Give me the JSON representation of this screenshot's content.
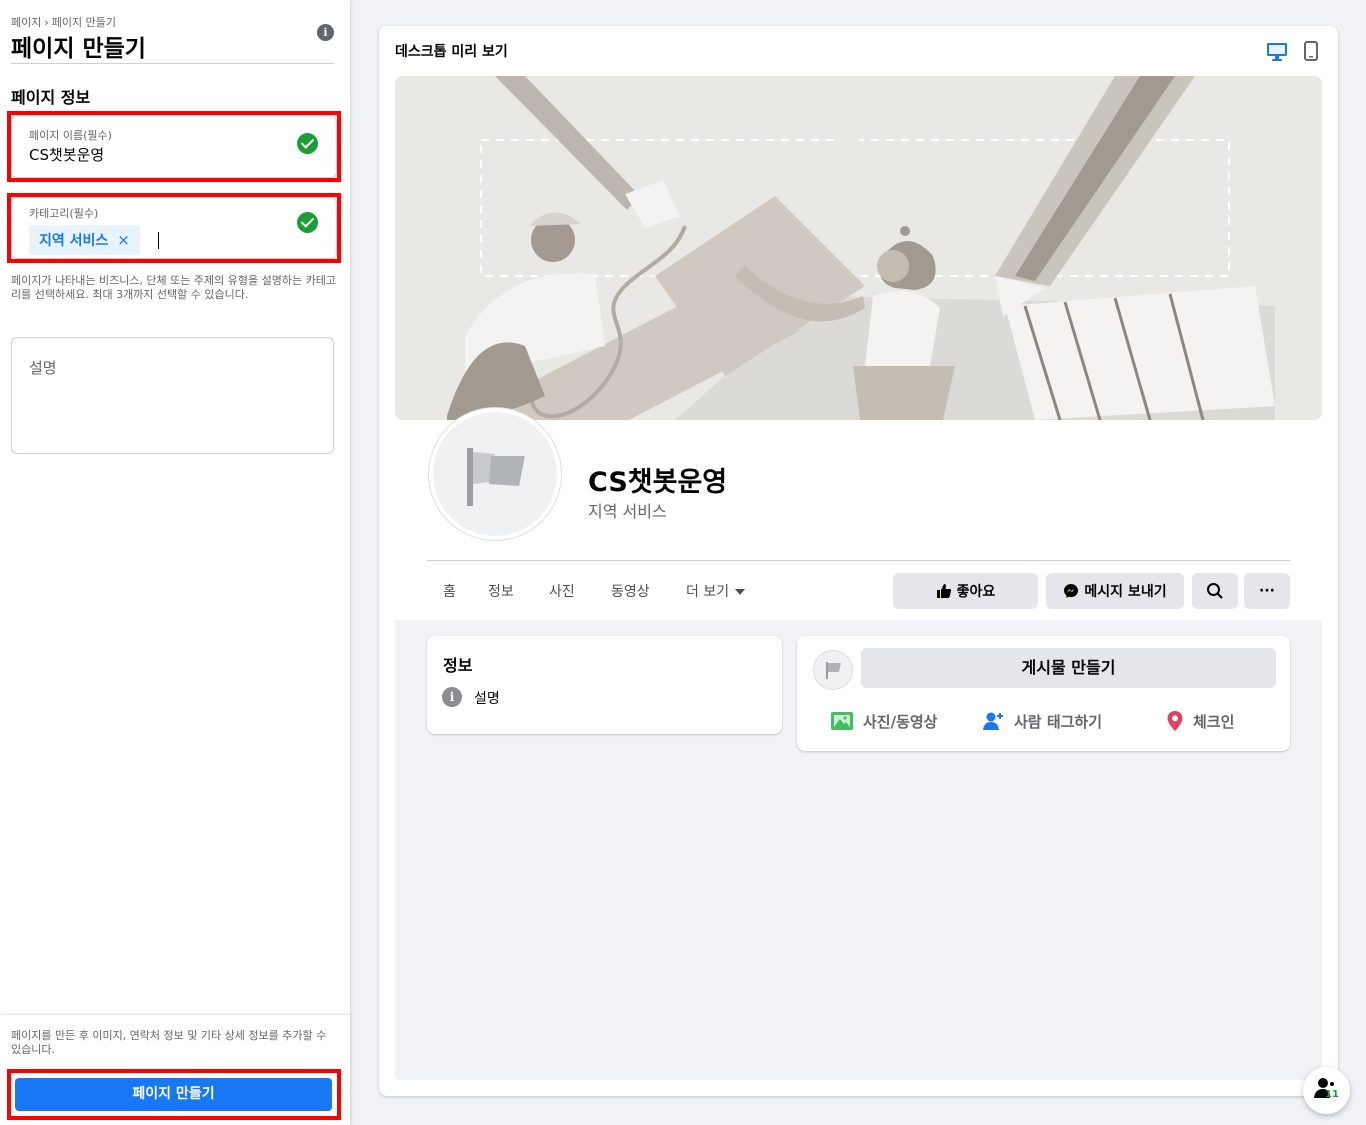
{
  "sidebar": {
    "breadcrumb": [
      "페이지",
      "페이지 만들기"
    ],
    "breadcrumb_separator": "›",
    "title": "페이지 만들기",
    "section_title": "페이지 정보",
    "name_field": {
      "label": "페이지 이름(필수)",
      "value": "CS챗봇운영",
      "valid": true
    },
    "category_field": {
      "label": "카테고리(필수)",
      "chips": [
        "지역 서비스"
      ],
      "chip_remove_icon": "×",
      "valid": true
    },
    "category_help": "페이지가 나타내는 비즈니스, 단체 또는 주제의 유형을 설명하는 카테고리를 선택하세요. 최대 3개까지 선택할 수 있습니다.",
    "description_field": {
      "placeholder": "설명",
      "value": ""
    },
    "footer_text": "페이지를 만든 후 이미지, 연락처 정보 및 기타 상세 정보를 추가할 수 있습니다.",
    "create_button": "페이지 만들기",
    "info_icon": "i"
  },
  "preview": {
    "title": "데스크톱 미리 보기",
    "view_modes": [
      "desktop-icon",
      "mobile-icon"
    ],
    "active_view": "desktop",
    "page_name": "CS챗봇운영",
    "page_category": "지역 서비스",
    "tabs": [
      "홈",
      "정보",
      "사진",
      "동영상",
      "더 보기"
    ],
    "actions": {
      "like": "좋아요",
      "message": "메시지 보내기",
      "search_icon": "search-icon",
      "more": "···"
    },
    "about": {
      "title": "정보",
      "description": "설명",
      "icon": "i"
    },
    "composer": {
      "button": "게시물 만들기",
      "actions": [
        "사진/동영상",
        "사람 태그하기",
        "체크인"
      ]
    }
  },
  "floating": {
    "badge": "11"
  },
  "colors": {
    "accent": "#1877f2",
    "success": "#1a9e36",
    "highlight": "#ff0000",
    "checkin": "#e4405f"
  }
}
